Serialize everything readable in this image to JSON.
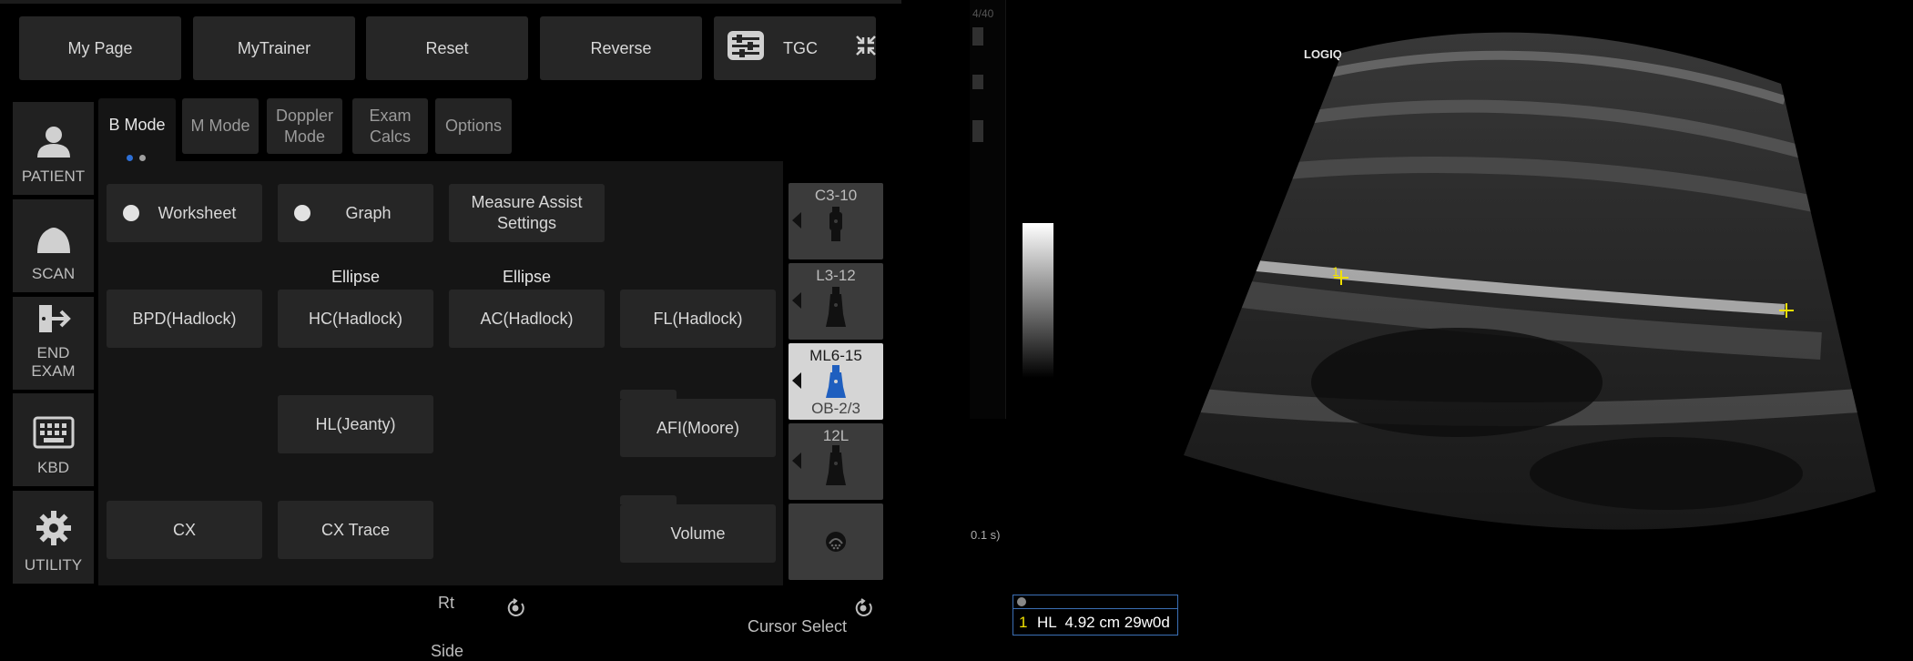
{
  "top_buttons": [
    "My Page",
    "MyTrainer",
    "Reset",
    "Reverse"
  ],
  "tgc_button": {
    "label": "TGC",
    "icon": "tgc-sliders-icon",
    "collapse_icon": "collapse-arrows-icon"
  },
  "sidebar": [
    {
      "label": "PATIENT",
      "icon": "patient-icon"
    },
    {
      "label": "SCAN",
      "icon": "probe-icon"
    },
    {
      "label": "END\nEXAM",
      "icon": "exit-icon"
    },
    {
      "label": "KBD",
      "icon": "keyboard-icon"
    },
    {
      "label": "UTILITY",
      "icon": "gear-icon"
    }
  ],
  "tabs": [
    "B Mode",
    "M Mode",
    "Doppler\nMode",
    "Exam\nCalcs",
    "Options"
  ],
  "calc_panel": {
    "worksheet": "Worksheet",
    "graph": "Graph",
    "measure_assist": "Measure Assist\nSettings",
    "caption_hc": "Ellipse",
    "caption_ac": "Ellipse",
    "bpd": "BPD(Hadlock)",
    "hc": "HC(Hadlock)",
    "ac": "AC(Hadlock)",
    "fl": "FL(Hadlock)",
    "hl": "HL(Jeanty)",
    "afi": "AFI(Moore)",
    "cx": "CX",
    "cx_trace": "CX Trace",
    "volume": "Volume"
  },
  "probes": [
    {
      "name": "C3-10",
      "sub": "",
      "selected": false
    },
    {
      "name": "L3-12",
      "sub": "",
      "selected": false
    },
    {
      "name": "ML6-15",
      "sub": "OB-2/3",
      "selected": true
    },
    {
      "name": "12L",
      "sub": "",
      "selected": false
    }
  ],
  "knobs": {
    "rt_label": "Rt",
    "side_label": "Side",
    "cursor_select": "Cursor Select"
  },
  "image": {
    "brand": "LOGIQ",
    "top_left_text": "4/40",
    "time_text": "0.1 s)",
    "marker_1": "1",
    "measurement": {
      "index": "1",
      "text": "HL  4.92 cm 29w0d"
    }
  },
  "colors": {
    "caliper": "#f0e000",
    "selected_probe_icon": "#1f5fbf",
    "measure_box": "#3b6fb5"
  }
}
